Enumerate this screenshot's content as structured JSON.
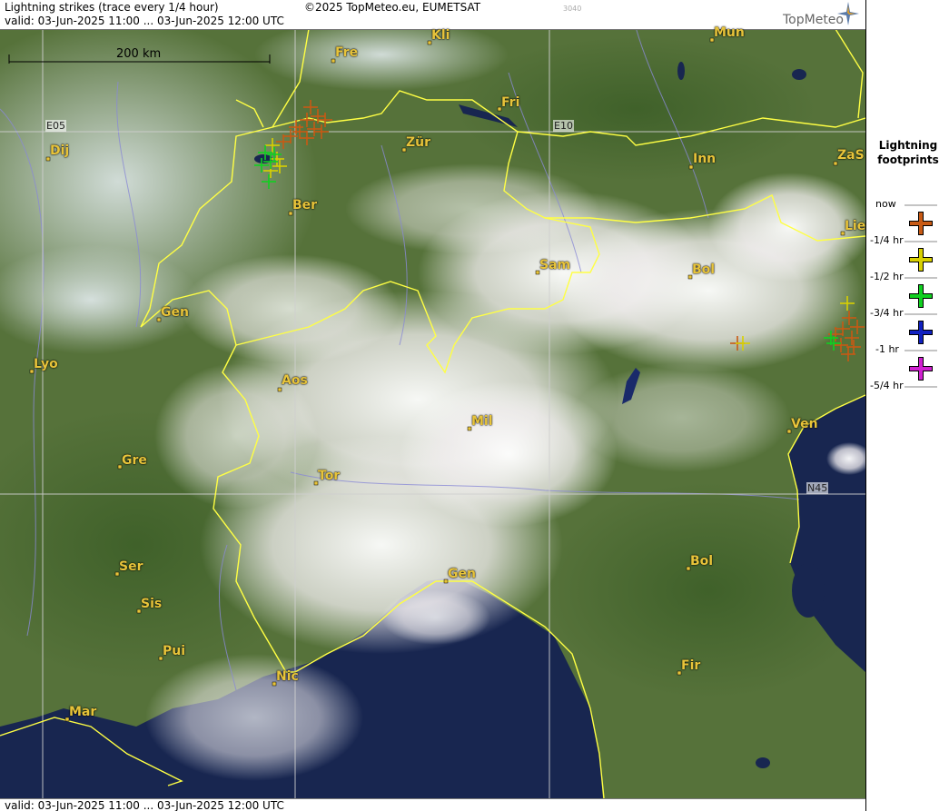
{
  "header": {
    "title": "Lightning strikes (trace every 1/4 hour)",
    "validity": "valid:  03-Jun-2025 11:00 ... 03-Jun-2025 12:00 UTC",
    "copyright": "©2025 TopMeteo.eu, EUMETSAT",
    "code": "3040",
    "logo": "TopMeteo",
    "logo_icon": "compass-star-icon"
  },
  "footer": {
    "validity": "valid:  03-Jun-2025 11:00 ... 03-Jun-2025 12:00 UTC"
  },
  "scale": {
    "label": "200 km"
  },
  "grid_labels": {
    "e05": "E05",
    "e10": "E10",
    "n45": "N45"
  },
  "cities": [
    {
      "name": "Kli"
    },
    {
      "name": "Mun"
    },
    {
      "name": "Fre"
    },
    {
      "name": "Fri"
    },
    {
      "name": "Dij"
    },
    {
      "name": "Zür"
    },
    {
      "name": "Inn"
    },
    {
      "name": "ZaS"
    },
    {
      "name": "Ber"
    },
    {
      "name": "Lie"
    },
    {
      "name": "Sam"
    },
    {
      "name": "Bol"
    },
    {
      "name": "Gen"
    },
    {
      "name": "Lyo"
    },
    {
      "name": "Aos"
    },
    {
      "name": "Mil"
    },
    {
      "name": "Ven"
    },
    {
      "name": "Gre"
    },
    {
      "name": "Tor"
    },
    {
      "name": "Ser"
    },
    {
      "name": "Gen"
    },
    {
      "name": "Bol"
    },
    {
      "name": "Sis"
    },
    {
      "name": "Pui"
    },
    {
      "name": "Nic"
    },
    {
      "name": "Fir"
    },
    {
      "name": "Mar"
    }
  ],
  "legend": {
    "title_line1": "Lightning",
    "title_line2": "footprints",
    "times": [
      "now",
      "-1/4 hr",
      "-1/2 hr",
      "-3/4 hr",
      "-1 hr",
      "-5/4 hr"
    ],
    "markers": [
      {
        "color": "#c85a14",
        "icon": "plus-icon"
      },
      {
        "color": "#d8d000",
        "icon": "plus-icon"
      },
      {
        "color": "#10d020",
        "icon": "plus-icon"
      },
      {
        "color": "#1020c0",
        "icon": "plus-icon"
      },
      {
        "color": "#d020d0",
        "icon": "plus-icon"
      }
    ]
  },
  "colors": {
    "sea": "#1a2a55",
    "land": "#4a6a32",
    "border": "#ffff40",
    "river": "#8a8ad0",
    "cloud": "#f0f0f0"
  }
}
